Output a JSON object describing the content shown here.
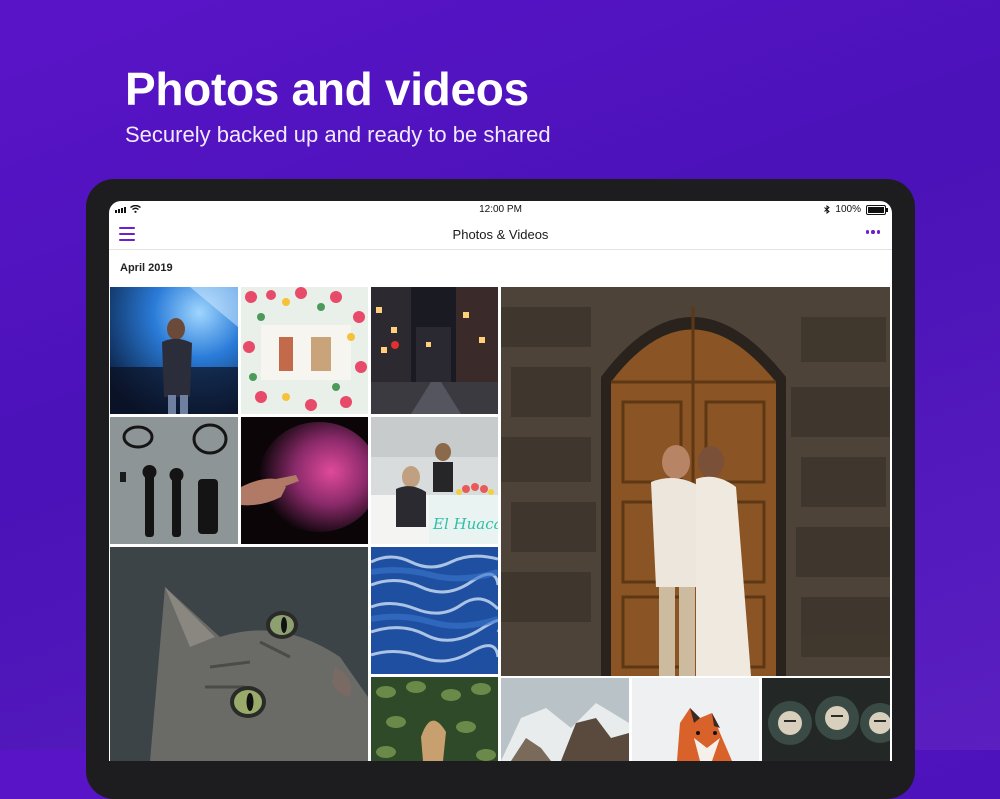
{
  "promo": {
    "headline": "Photos and videos",
    "subline": "Securely backed up and ready to be shared"
  },
  "status_bar": {
    "time": "12:00 PM",
    "battery": "100%"
  },
  "nav": {
    "title": "Photos & Videos"
  },
  "gallery": {
    "section_label": "April 2019",
    "photos": [
      {
        "name": "concert-singer-photo"
      },
      {
        "name": "flowers-flatlay-photo"
      },
      {
        "name": "night-street-photo"
      },
      {
        "name": "couple-wooden-door-photo"
      },
      {
        "name": "microphones-cables-photo"
      },
      {
        "name": "pink-powder-hand-photo"
      },
      {
        "name": "cafe-counter-photo",
        "sign_text": "El Huaca"
      },
      {
        "name": "cat-closeup-photo"
      },
      {
        "name": "ocean-waves-photo"
      },
      {
        "name": "leaves-photo"
      },
      {
        "name": "snow-rocks-photo"
      },
      {
        "name": "fox-in-snow-photo"
      },
      {
        "name": "wine-barrels-photo"
      }
    ]
  },
  "colors": {
    "accent": "#6a1fd0",
    "background": "#5a14c8"
  }
}
